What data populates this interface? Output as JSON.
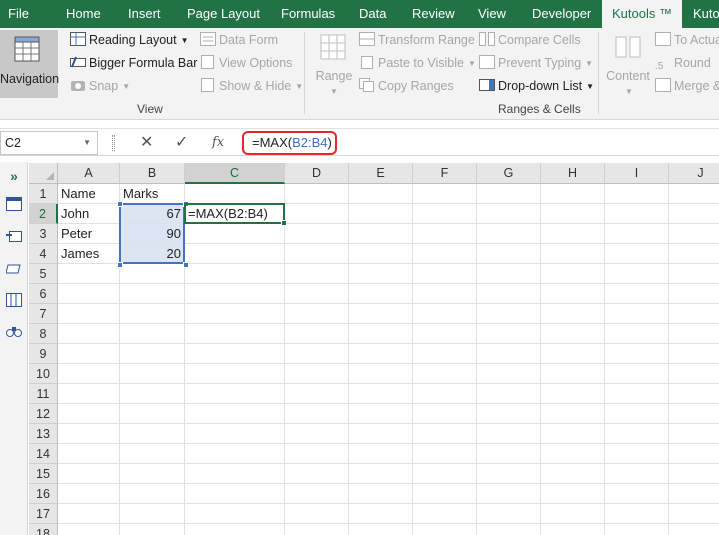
{
  "tabs": [
    "File",
    "Home",
    "Insert",
    "Page Layout",
    "Formulas",
    "Data",
    "Review",
    "View",
    "Developer",
    "Kutools ™",
    "Kuto"
  ],
  "ribbon": {
    "navigation_label": "Navigation",
    "view_group": {
      "reading_layout": "Reading Layout",
      "bigger_formula_bar": "Bigger Formula Bar",
      "snap": "Snap",
      "data_form": "Data Form",
      "view_options": "View Options",
      "show_hide": "Show & Hide",
      "group_label": "View"
    },
    "ranges_group": {
      "range": "Range",
      "transform_range": "Transform Range",
      "paste_to_visible": "Paste to Visible",
      "copy_ranges": "Copy Ranges",
      "compare_cells": "Compare Cells",
      "prevent_typing": "Prevent Typing",
      "dropdown_list": "Drop-down List",
      "group_label": "Ranges & Cells"
    },
    "content_group": {
      "content": "Content",
      "to_actual": "To Actua",
      "round": "Round",
      "merge": "Merge &"
    }
  },
  "formula_bar": {
    "name_box": "C2",
    "cancel_symbol": "✕",
    "enter_symbol": "✓",
    "fx_symbol": "fx",
    "formula_prefix": "=MAX(",
    "formula_ref": "B2:B4",
    "formula_suffix": ")"
  },
  "grid": {
    "columns": [
      "A",
      "B",
      "C",
      "D",
      "E",
      "F",
      "G",
      "H",
      "I",
      "J"
    ],
    "rows": [
      "1",
      "2",
      "3",
      "4",
      "5",
      "6",
      "7",
      "8",
      "9",
      "10",
      "11",
      "12",
      "13",
      "14",
      "15",
      "16",
      "17",
      "18"
    ],
    "cells": {
      "A1": "Name",
      "B1": "Marks",
      "A2": "John",
      "B2": "67",
      "C2": "=MAX(B2:B4)",
      "A3": "Peter",
      "B3": "90",
      "A4": "James",
      "B4": "20"
    },
    "active_cell": "C2",
    "selected_range": "B2:B4"
  },
  "colors": {
    "accent": "#217346",
    "range_highlight": "#4472c4",
    "callout": "#e0292a"
  }
}
